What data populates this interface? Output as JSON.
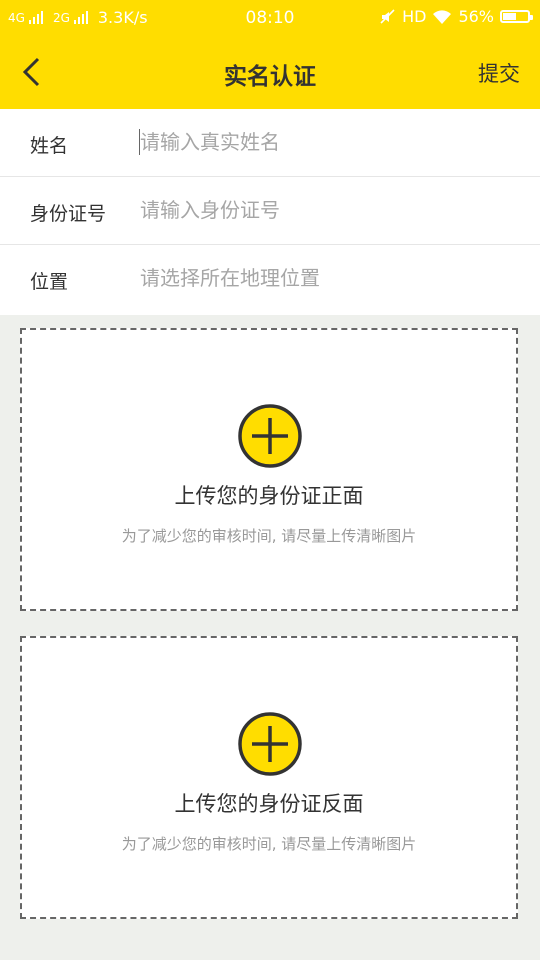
{
  "status_bar": {
    "network1": "4G",
    "network2": "2G",
    "speed": "3.3K/s",
    "time": "08:10",
    "hd": "HD",
    "battery": "56%",
    "battery_level": 0.56
  },
  "header": {
    "title": "实名认证",
    "submit_label": "提交",
    "accent_color": "#ffdd00"
  },
  "form": {
    "name": {
      "label": "姓名",
      "placeholder": "请输入真实姓名",
      "value": ""
    },
    "id_number": {
      "label": "身份证号",
      "placeholder": "请输入身份证号",
      "value": ""
    },
    "location": {
      "label": "位置",
      "placeholder": "请选择所在地理位置",
      "value": ""
    }
  },
  "uploads": [
    {
      "title": "上传您的身份证正面",
      "hint": "为了减少您的审核时间, 请尽量上传清晰图片",
      "icon": "plus-circle-icon"
    },
    {
      "title": "上传您的身份证反面",
      "hint": "为了减少您的审核时间, 请尽量上传清晰图片",
      "icon": "plus-circle-icon"
    }
  ]
}
